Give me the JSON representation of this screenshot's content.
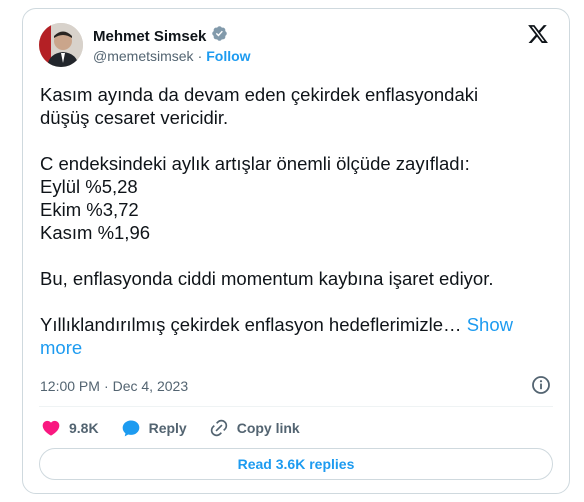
{
  "author": {
    "name": "Mehmet Simsek",
    "handle": "@memetsimsek",
    "separator": "·",
    "follow_label": "Follow",
    "avatar_icon": "profile-photo",
    "verified_icon": "verified-badge-icon"
  },
  "tweet": {
    "lines": [
      "Kasım ayında da devam eden çekirdek enflasyondaki",
      "düşüş cesaret vericidir.",
      "",
      "C endeksindeki aylık artışlar önemli ölçüde zayıfladı:",
      "Eylül %5,28",
      "Ekim %3,72",
      "Kasım %1,96",
      "",
      "Bu, enflasyonda ciddi momentum kaybına işaret ediyor.",
      ""
    ],
    "truncated_text": "Yıllıklandırılmış çekirdek enflasyon hedeflerimizle…",
    "show_more_label": "Show",
    "show_more_label_2": "more"
  },
  "meta": {
    "time": "12:00 PM",
    "separator": "·",
    "date": "Dec 4, 2023"
  },
  "actions": {
    "likes": "9.8K",
    "reply_label": "Reply",
    "copy_label": "Copy link"
  },
  "read_replies_label": "Read 3.6K replies",
  "colors": {
    "accent": "#1d9bf0",
    "like": "#f91880",
    "text": "#0f1419",
    "muted": "#536471"
  }
}
